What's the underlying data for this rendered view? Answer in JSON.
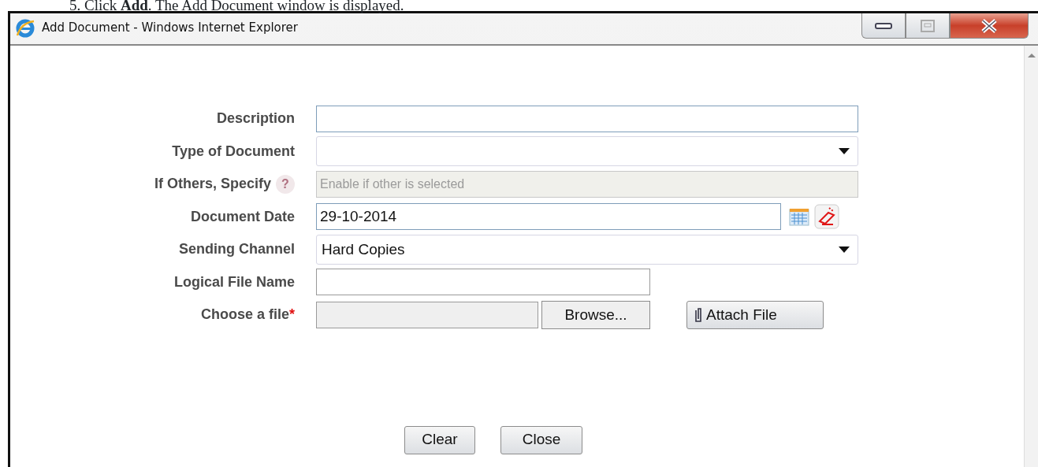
{
  "instruction": "5. Click **Add**. The Add Document window is displayed.",
  "window": {
    "title": "Add Document - Windows Internet Explorer"
  },
  "fields": [
    {
      "kind": "text",
      "label": "Description"
    },
    {
      "kind": "select",
      "label": "Type of Document"
    },
    {
      "kind": "disabled",
      "label": "If Others, Specify",
      "help_icon": "?",
      "placeholder": "Enable if other is selected"
    },
    {
      "kind": "date",
      "label": "Document Date",
      "value": "29-10-2014"
    },
    {
      "kind": "select",
      "label": "Sending Channel",
      "value": "Hard Copies"
    },
    {
      "kind": "short",
      "label": "Logical File Name"
    },
    {
      "kind": "file",
      "label": "Choose a file",
      "required_mark": "*",
      "browse": "Browse...",
      "attach": "Attach File"
    }
  ],
  "buttons": [
    "Clear",
    "Close"
  ]
}
